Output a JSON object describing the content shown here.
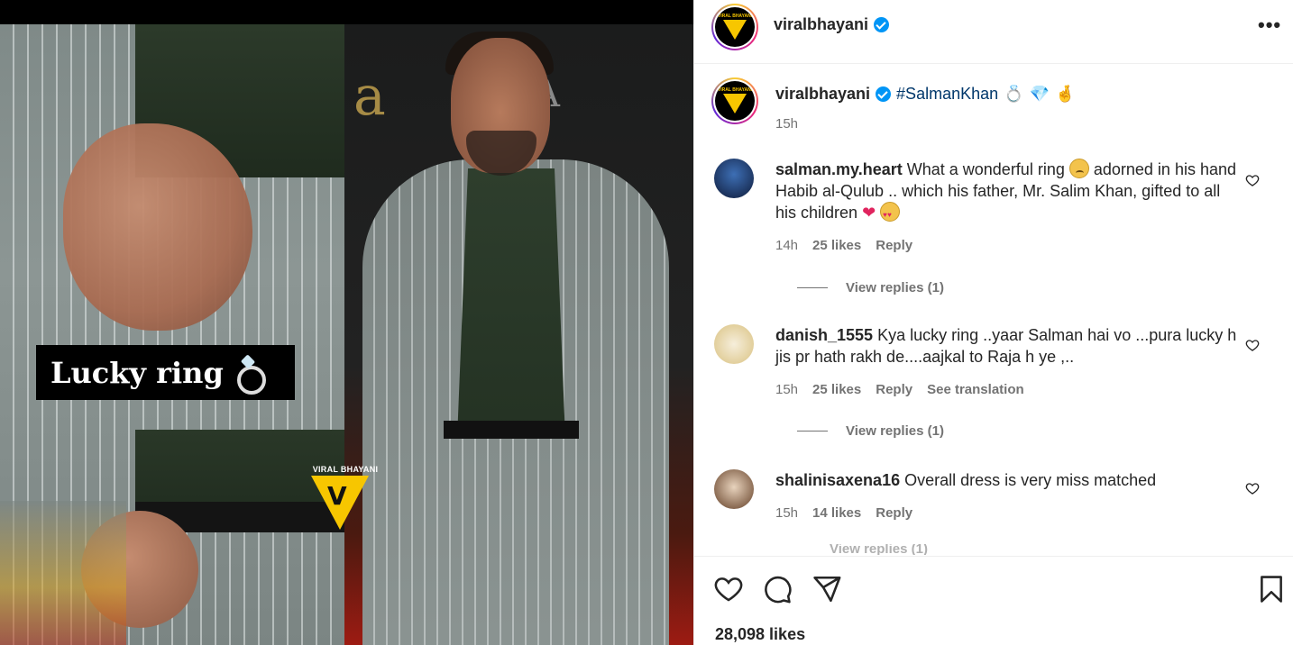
{
  "media": {
    "overlay_label": "Lucky ring",
    "watermark": "VIRAL BHAYANI"
  },
  "header": {
    "username": "viralbhayani",
    "more_icon": "more-horizontal-icon"
  },
  "caption": {
    "username": "viralbhayani",
    "hashtag": "#SalmanKhan",
    "emojis": [
      "ring",
      "gem",
      "crossed-fingers"
    ],
    "time": "15h"
  },
  "comments": [
    {
      "username": "salman.my.heart",
      "text": "What a wonderful ring",
      "text_after_emoji": "adorned in his hand Habib al-Qulub .. which his father, Mr. Salim Khan, gifted to all his children",
      "time": "14h",
      "likes": "25 likes",
      "reply": "Reply",
      "view_replies": "View replies (1)"
    },
    {
      "username": "danish_1555",
      "text": "Kya lucky ring ..yaar Salman hai vo ...pura lucky h jis pr hath rakh de....aajkal to Raja h ye ,..",
      "time": "15h",
      "likes": "25 likes",
      "reply": "Reply",
      "see_translation": "See translation",
      "view_replies": "View replies (1)"
    },
    {
      "username": "shalinisaxena16",
      "text": "Overall dress is very miss matched",
      "time": "15h",
      "likes": "14 likes",
      "reply": "Reply",
      "view_replies": "View replies (1)"
    }
  ],
  "actions": {
    "likes": "28,098 likes"
  },
  "colors": {
    "verified": "#0095f6",
    "hashtag": "#00376b",
    "muted": "#737373",
    "watermark_yellow": "#f7c600"
  }
}
